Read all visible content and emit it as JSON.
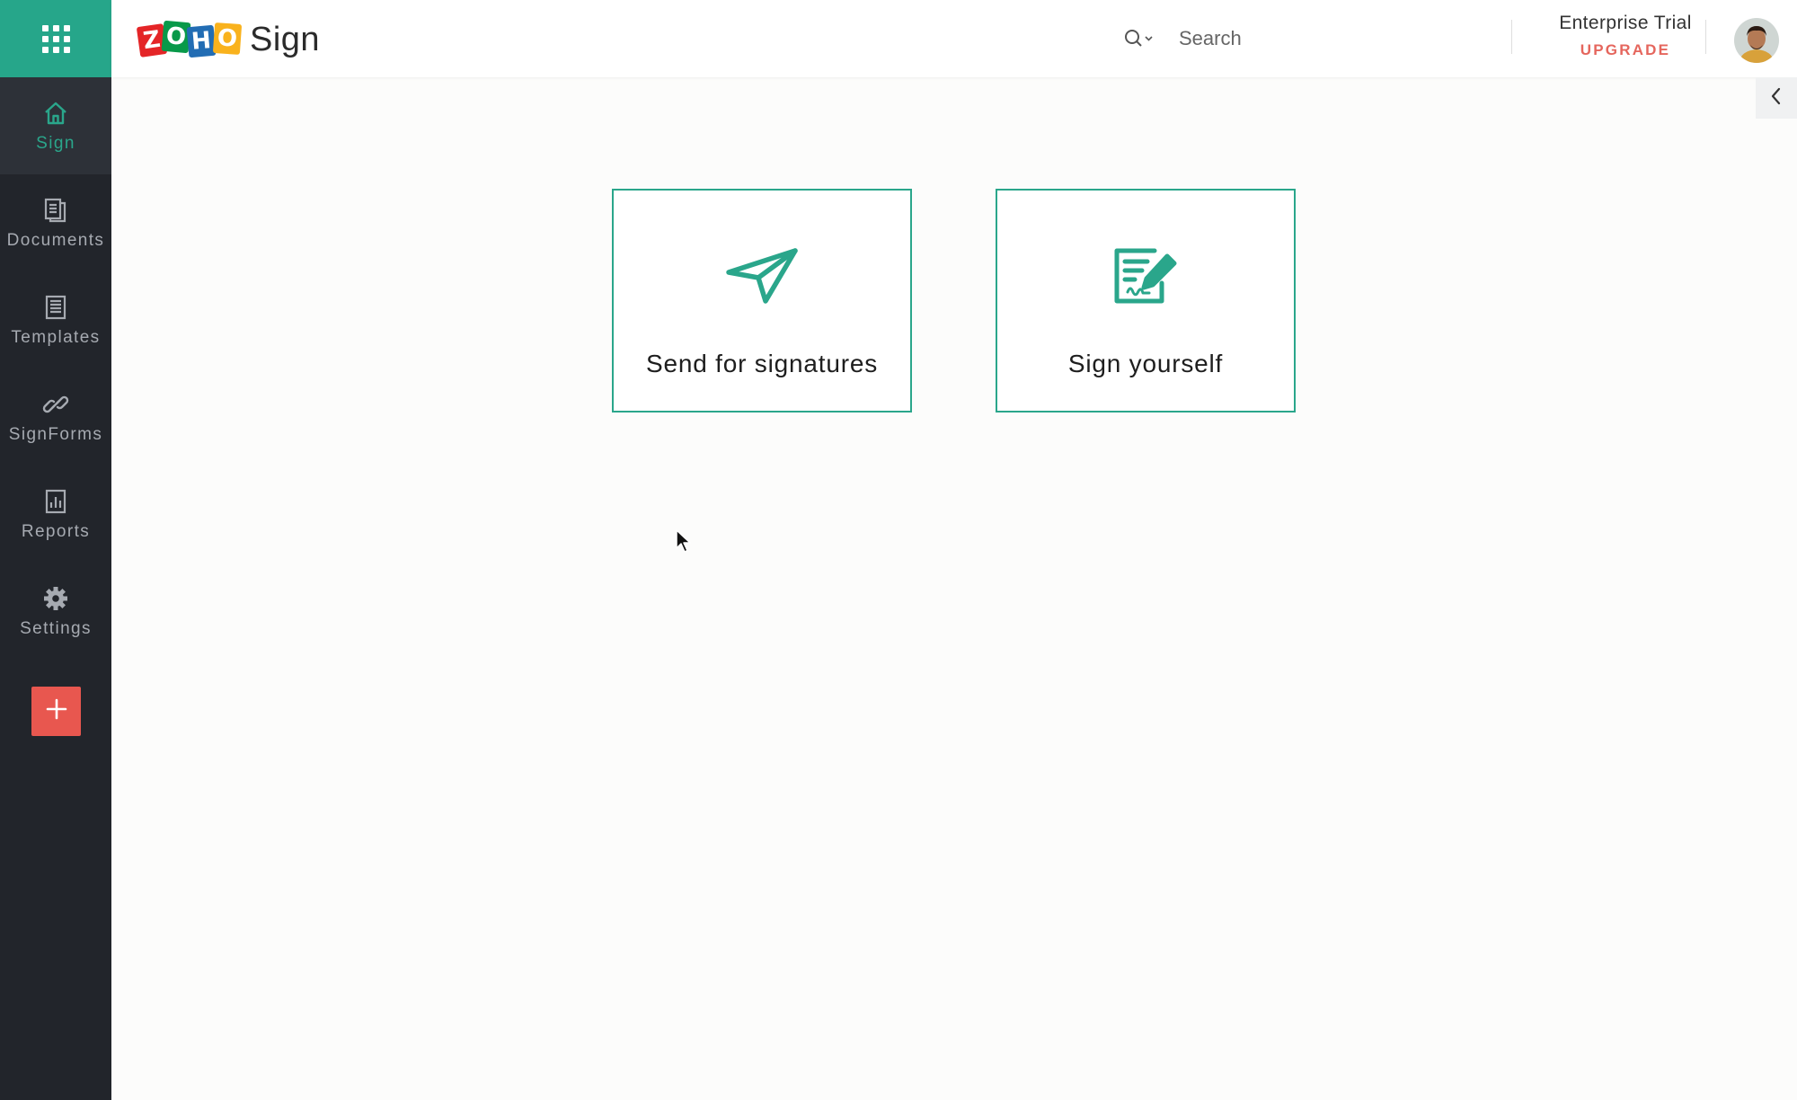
{
  "app": {
    "name": "Sign",
    "logo_letters": [
      "Z",
      "O",
      "H",
      "O"
    ]
  },
  "colors": {
    "brand_green": "#2aa68b",
    "sidebar_bg": "#22252b",
    "add_button": "#e8574f",
    "upgrade_text": "#e5665d",
    "zoho_tiles": [
      "#e42527",
      "#089949",
      "#226db4",
      "#f9b21d"
    ]
  },
  "header": {
    "search_placeholder": "Search",
    "plan_name": "Enterprise Trial",
    "upgrade_label": "UPGRADE"
  },
  "sidebar": {
    "items": [
      {
        "label": "Sign",
        "icon": "home-icon",
        "active": true
      },
      {
        "label": "Documents",
        "icon": "documents-icon",
        "active": false
      },
      {
        "label": "Templates",
        "icon": "templates-icon",
        "active": false
      },
      {
        "label": "SignForms",
        "icon": "link-icon",
        "active": false
      },
      {
        "label": "Reports",
        "icon": "reports-icon",
        "active": false
      },
      {
        "label": "Settings",
        "icon": "gear-icon",
        "active": false
      }
    ],
    "add_icon": "plus-icon"
  },
  "main": {
    "cards": [
      {
        "label": "Send for signatures",
        "icon": "paper-plane-icon"
      },
      {
        "label": "Sign yourself",
        "icon": "sign-document-icon"
      }
    ]
  }
}
